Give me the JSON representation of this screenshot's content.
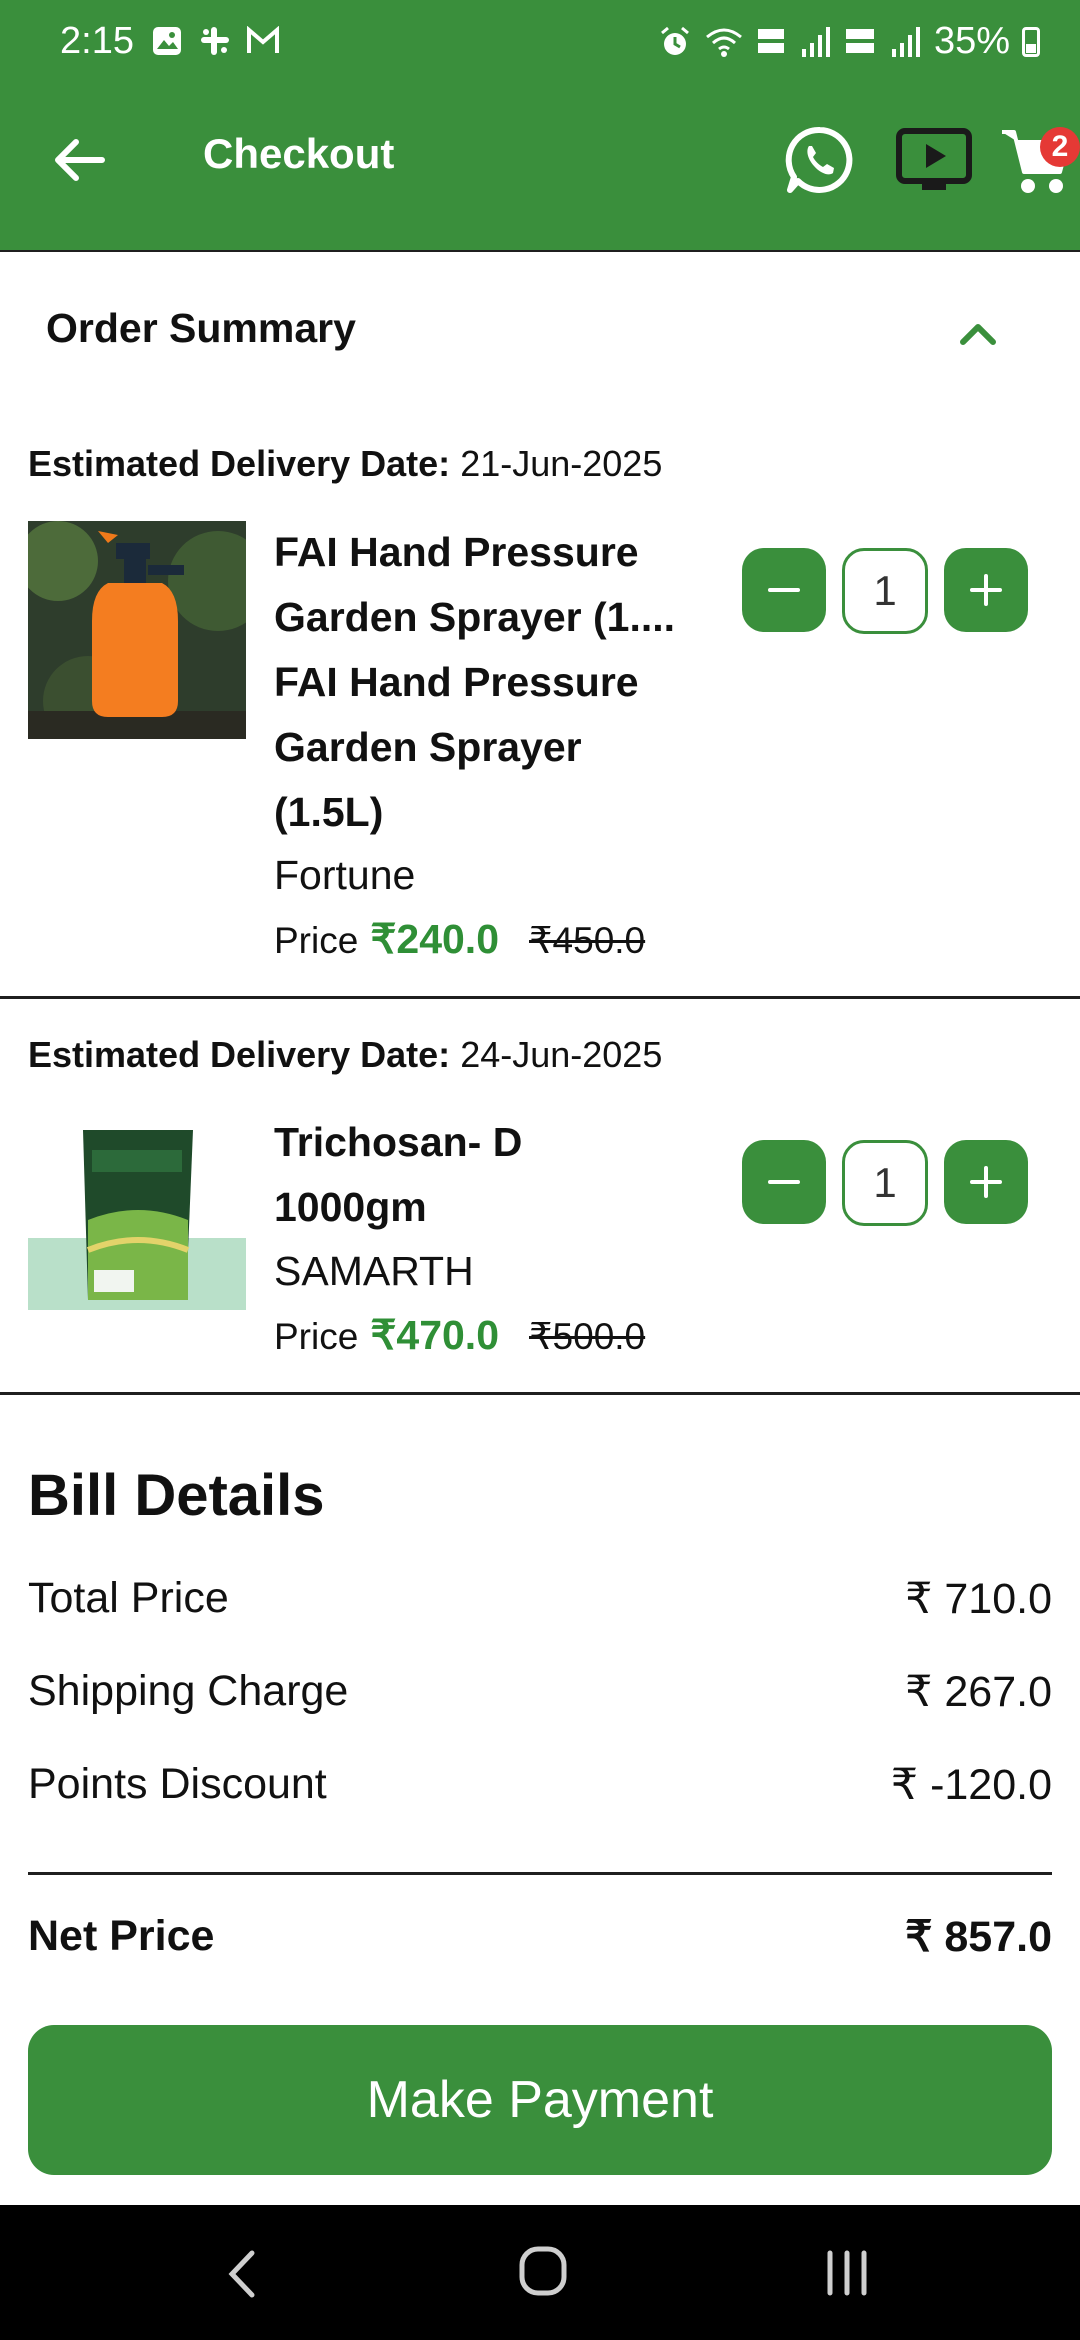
{
  "status_bar": {
    "time": "2:15",
    "battery": "35%",
    "icons_left": [
      "gallery-icon",
      "slack-icon",
      "gmail-icon"
    ],
    "icons_right": [
      "alarm-icon",
      "wifi-icon",
      "volte-5g-icon",
      "signal-icon",
      "volte-lte2-icon",
      "signal-icon",
      "battery-icon"
    ]
  },
  "header": {
    "title": "Checkout",
    "cart_count": "2",
    "accent_color": "#3a8f3c"
  },
  "order_summary": {
    "title": "Order Summary",
    "items": [
      {
        "delivery_label": "Estimated Delivery Date:",
        "delivery_date": "21-Jun-2025",
        "name_lines": [
          "FAI Hand Pressure",
          "Garden Sprayer (1....",
          "FAI Hand Pressure",
          "Garden Sprayer",
          "(1.5L)"
        ],
        "brand": "Fortune",
        "price_label": "Price",
        "price": "₹240.0",
        "mrp": "₹450.0",
        "quantity": "1"
      },
      {
        "delivery_label": "Estimated Delivery Date:",
        "delivery_date": "24-Jun-2025",
        "name_lines": [
          "Trichosan- D",
          "1000gm"
        ],
        "brand": "SAMARTH",
        "price_label": "Price",
        "price": "₹470.0",
        "mrp": "₹500.0",
        "quantity": "1"
      }
    ]
  },
  "bill": {
    "title": "Bill Details",
    "rows": [
      {
        "label": "Total Price",
        "value": "₹ 710.0"
      },
      {
        "label": "Shipping Charge",
        "value": "₹ 267.0"
      },
      {
        "label": "Points Discount",
        "value": "₹ -120.0"
      }
    ],
    "net_label": "Net Price",
    "net_value": "₹ 857.0"
  },
  "actions": {
    "pay_label": "Make Payment"
  }
}
